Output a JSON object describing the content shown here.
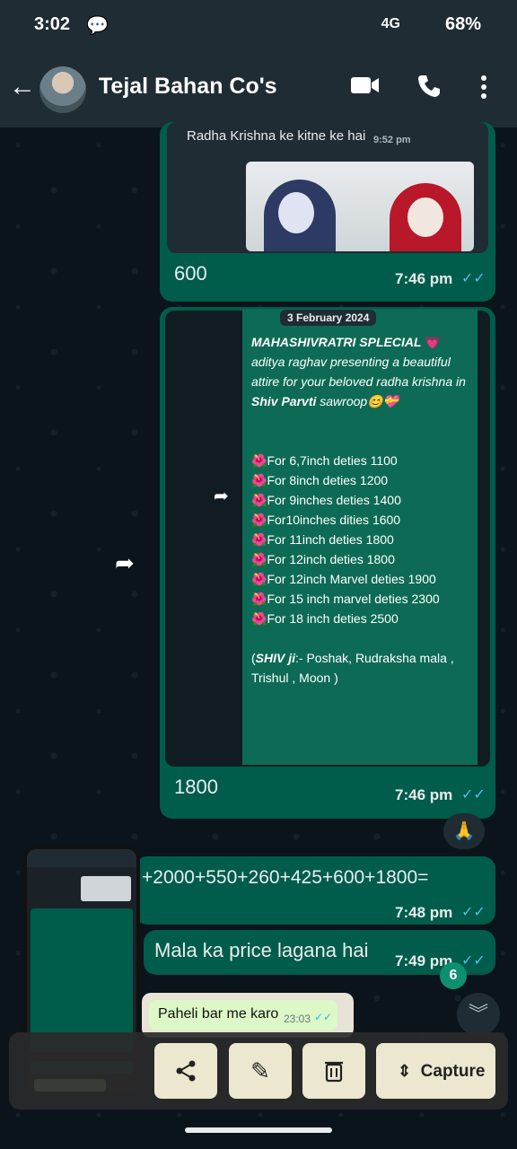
{
  "status": {
    "time": "3:02",
    "battery": "68%",
    "network": "4G"
  },
  "header": {
    "title": "Tejal Bahan Co's",
    "back_icon": "arrow-left-icon",
    "video_icon": "video-call-icon",
    "call_icon": "phone-icon",
    "menu_icon": "more-vertical-icon"
  },
  "quote": {
    "text": "Radha Krishna ke kitne ke hai",
    "time": "9:52 pm"
  },
  "msg1": {
    "text": "600",
    "time": "7:46 pm"
  },
  "promo": {
    "date": "3 February 2024",
    "title": "MAHASHIVRATRI SPLECIAL",
    "intro": "aditya raghav presenting a beautiful attire for your beloved radha krishna in",
    "intro_bold": "Shiv Parvti",
    "intro_end": "sawroop",
    "items": [
      "For 6,7inch deties 1100",
      "For 8inch deties 1200",
      "For 9inches deties 1400",
      "For10inches dities 1600",
      "For 11inch deties 1800",
      "For 12inch deties 1800",
      "For 12inch Marvel deties 1900",
      "For 15 inch marvel deties 2300",
      "For 18 inch deties 2500"
    ],
    "footer_bold": "SHIV ji",
    "footer": ":- Poshak, Rudraksha mala , Trishul , Moon )"
  },
  "msg2": {
    "text": "1800",
    "time": "7:46 pm"
  },
  "reaction": "🙏",
  "msg3": {
    "text": "+2000+550+260+425+600+1800=",
    "time": "7:48 pm"
  },
  "msg4": {
    "text": "Mala ka price lagana hai",
    "time": "7:49 pm"
  },
  "msg5": {
    "text": "Paheli bar me karo",
    "time": "23:03"
  },
  "unread": "6",
  "toolbar": {
    "capture": "Capture"
  }
}
